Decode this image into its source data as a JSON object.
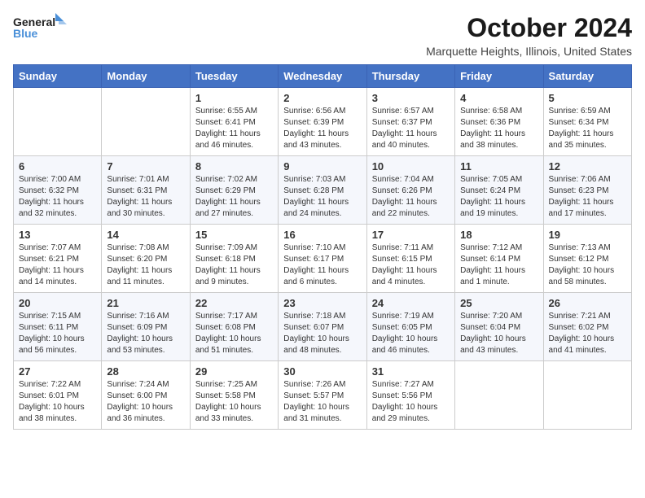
{
  "logo": {
    "line1": "General",
    "line2": "Blue"
  },
  "title": "October 2024",
  "location": "Marquette Heights, Illinois, United States",
  "weekdays": [
    "Sunday",
    "Monday",
    "Tuesday",
    "Wednesday",
    "Thursday",
    "Friday",
    "Saturday"
  ],
  "weeks": [
    [
      {
        "day": "",
        "info": ""
      },
      {
        "day": "",
        "info": ""
      },
      {
        "day": "1",
        "info": "Sunrise: 6:55 AM\nSunset: 6:41 PM\nDaylight: 11 hours and 46 minutes."
      },
      {
        "day": "2",
        "info": "Sunrise: 6:56 AM\nSunset: 6:39 PM\nDaylight: 11 hours and 43 minutes."
      },
      {
        "day": "3",
        "info": "Sunrise: 6:57 AM\nSunset: 6:37 PM\nDaylight: 11 hours and 40 minutes."
      },
      {
        "day": "4",
        "info": "Sunrise: 6:58 AM\nSunset: 6:36 PM\nDaylight: 11 hours and 38 minutes."
      },
      {
        "day": "5",
        "info": "Sunrise: 6:59 AM\nSunset: 6:34 PM\nDaylight: 11 hours and 35 minutes."
      }
    ],
    [
      {
        "day": "6",
        "info": "Sunrise: 7:00 AM\nSunset: 6:32 PM\nDaylight: 11 hours and 32 minutes."
      },
      {
        "day": "7",
        "info": "Sunrise: 7:01 AM\nSunset: 6:31 PM\nDaylight: 11 hours and 30 minutes."
      },
      {
        "day": "8",
        "info": "Sunrise: 7:02 AM\nSunset: 6:29 PM\nDaylight: 11 hours and 27 minutes."
      },
      {
        "day": "9",
        "info": "Sunrise: 7:03 AM\nSunset: 6:28 PM\nDaylight: 11 hours and 24 minutes."
      },
      {
        "day": "10",
        "info": "Sunrise: 7:04 AM\nSunset: 6:26 PM\nDaylight: 11 hours and 22 minutes."
      },
      {
        "day": "11",
        "info": "Sunrise: 7:05 AM\nSunset: 6:24 PM\nDaylight: 11 hours and 19 minutes."
      },
      {
        "day": "12",
        "info": "Sunrise: 7:06 AM\nSunset: 6:23 PM\nDaylight: 11 hours and 17 minutes."
      }
    ],
    [
      {
        "day": "13",
        "info": "Sunrise: 7:07 AM\nSunset: 6:21 PM\nDaylight: 11 hours and 14 minutes."
      },
      {
        "day": "14",
        "info": "Sunrise: 7:08 AM\nSunset: 6:20 PM\nDaylight: 11 hours and 11 minutes."
      },
      {
        "day": "15",
        "info": "Sunrise: 7:09 AM\nSunset: 6:18 PM\nDaylight: 11 hours and 9 minutes."
      },
      {
        "day": "16",
        "info": "Sunrise: 7:10 AM\nSunset: 6:17 PM\nDaylight: 11 hours and 6 minutes."
      },
      {
        "day": "17",
        "info": "Sunrise: 7:11 AM\nSunset: 6:15 PM\nDaylight: 11 hours and 4 minutes."
      },
      {
        "day": "18",
        "info": "Sunrise: 7:12 AM\nSunset: 6:14 PM\nDaylight: 11 hours and 1 minute."
      },
      {
        "day": "19",
        "info": "Sunrise: 7:13 AM\nSunset: 6:12 PM\nDaylight: 10 hours and 58 minutes."
      }
    ],
    [
      {
        "day": "20",
        "info": "Sunrise: 7:15 AM\nSunset: 6:11 PM\nDaylight: 10 hours and 56 minutes."
      },
      {
        "day": "21",
        "info": "Sunrise: 7:16 AM\nSunset: 6:09 PM\nDaylight: 10 hours and 53 minutes."
      },
      {
        "day": "22",
        "info": "Sunrise: 7:17 AM\nSunset: 6:08 PM\nDaylight: 10 hours and 51 minutes."
      },
      {
        "day": "23",
        "info": "Sunrise: 7:18 AM\nSunset: 6:07 PM\nDaylight: 10 hours and 48 minutes."
      },
      {
        "day": "24",
        "info": "Sunrise: 7:19 AM\nSunset: 6:05 PM\nDaylight: 10 hours and 46 minutes."
      },
      {
        "day": "25",
        "info": "Sunrise: 7:20 AM\nSunset: 6:04 PM\nDaylight: 10 hours and 43 minutes."
      },
      {
        "day": "26",
        "info": "Sunrise: 7:21 AM\nSunset: 6:02 PM\nDaylight: 10 hours and 41 minutes."
      }
    ],
    [
      {
        "day": "27",
        "info": "Sunrise: 7:22 AM\nSunset: 6:01 PM\nDaylight: 10 hours and 38 minutes."
      },
      {
        "day": "28",
        "info": "Sunrise: 7:24 AM\nSunset: 6:00 PM\nDaylight: 10 hours and 36 minutes."
      },
      {
        "day": "29",
        "info": "Sunrise: 7:25 AM\nSunset: 5:58 PM\nDaylight: 10 hours and 33 minutes."
      },
      {
        "day": "30",
        "info": "Sunrise: 7:26 AM\nSunset: 5:57 PM\nDaylight: 10 hours and 31 minutes."
      },
      {
        "day": "31",
        "info": "Sunrise: 7:27 AM\nSunset: 5:56 PM\nDaylight: 10 hours and 29 minutes."
      },
      {
        "day": "",
        "info": ""
      },
      {
        "day": "",
        "info": ""
      }
    ]
  ]
}
